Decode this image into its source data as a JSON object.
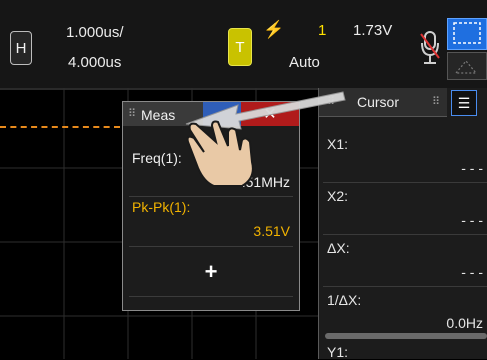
{
  "horizontal": {
    "button_label": "H",
    "time_per_div": "1.000us/",
    "delay": "4.000us"
  },
  "trigger": {
    "button_label": "T",
    "edge_symbol": "⚡",
    "source": "1",
    "level": "1.73V",
    "mode": "Auto"
  },
  "meas_dialog": {
    "title": "Meas",
    "close_glyph": "✕",
    "freq_label": "Freq(1):",
    "freq_value": "3.51MHz",
    "pkpk_label": "Pk-Pk(1):",
    "pkpk_value": "3.51V",
    "add_glyph": "+"
  },
  "cursor_panel": {
    "tab_label": "Cursor",
    "rows": [
      {
        "label": "X1:",
        "value": "- - -"
      },
      {
        "label": "X2:",
        "value": "- - -"
      },
      {
        "label": "ΔX:",
        "value": "- - -"
      },
      {
        "label": "1/ΔX:",
        "value": "0.0Hz"
      },
      {
        "label": "Y1:",
        "value": ""
      }
    ]
  },
  "colors": {
    "trigger": "#c9c200",
    "channel1": "#f2b300",
    "accent": "#1f6fe0",
    "close": "#b01b1b",
    "marker": "#e88a1c"
  }
}
